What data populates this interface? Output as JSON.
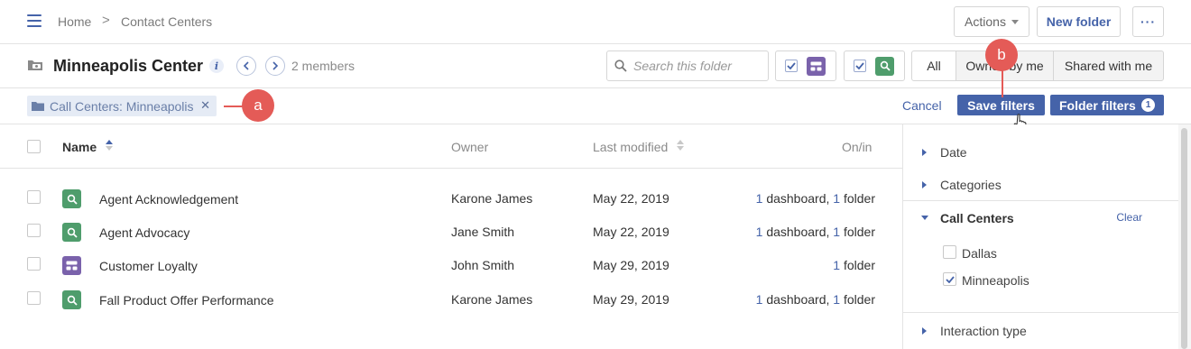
{
  "breadcrumb": {
    "home": "Home",
    "separator": ">",
    "current": "Contact Centers"
  },
  "toolbar": {
    "actions_label": "Actions",
    "new_folder_label": "New folder",
    "more_label": "···"
  },
  "folder": {
    "title": "Minneapolis Center",
    "info_label": "i",
    "members": "2 members"
  },
  "search": {
    "placeholder": "Search this folder"
  },
  "ownership_tabs": {
    "all": "All",
    "owned": "Owned by me",
    "shared": "Shared with me",
    "selected": "All"
  },
  "filters": {
    "chip_label": "Call Centers: Minneapolis",
    "chip_remove": "✕",
    "cancel_label": "Cancel",
    "save_label": "Save filters",
    "folder_filters_label": "Folder filters",
    "folder_filters_count": "1"
  },
  "callouts": {
    "a": "a",
    "b": "b"
  },
  "table": {
    "columns": {
      "name": "Name",
      "owner": "Owner",
      "last_modified": "Last modified",
      "on_in": "On/in"
    },
    "rows": [
      {
        "type": "search",
        "name": "Agent Acknowledgement",
        "owner": "Karone James",
        "modified": "May 22, 2019",
        "dash_num": "1",
        "dash_text": " dashboard, ",
        "folder_num": "1",
        "folder_text": " folder"
      },
      {
        "type": "search",
        "name": "Agent Advocacy",
        "owner": "Jane Smith",
        "modified": "May 22, 2019",
        "dash_num": "1",
        "dash_text": " dashboard, ",
        "folder_num": "1",
        "folder_text": " folder"
      },
      {
        "type": "dashboard",
        "name": "Customer Loyalty",
        "owner": "John Smith",
        "modified": "May 29, 2019",
        "dash_num": "",
        "dash_text": "",
        "folder_num": "1",
        "folder_text": " folder"
      },
      {
        "type": "search",
        "name": "Fall Product Offer Performance",
        "owner": "Karone James",
        "modified": "May 29, 2019",
        "dash_num": "1",
        "dash_text": " dashboard, ",
        "folder_num": "1",
        "folder_text": " folder"
      }
    ]
  },
  "filter_panel": {
    "date": "Date",
    "categories": "Categories",
    "call_centers": "Call Centers",
    "clear": "Clear",
    "options": [
      {
        "label": "Dallas",
        "checked": false
      },
      {
        "label": "Minneapolis",
        "checked": true
      }
    ],
    "interaction_type": "Interaction type"
  },
  "colors": {
    "accent": "#4563a9",
    "search_icon_bg": "#4f9d6c",
    "dashboard_icon_bg": "#7a62ab",
    "callout": "#e45b57",
    "chip_bg": "#e5ebf5"
  },
  "icons": {
    "menu": "hamburger-icon",
    "folder": "folder-icon",
    "search": "search-icon",
    "dashboard": "dashboard-icon",
    "pointer": "hand-pointer-icon"
  }
}
